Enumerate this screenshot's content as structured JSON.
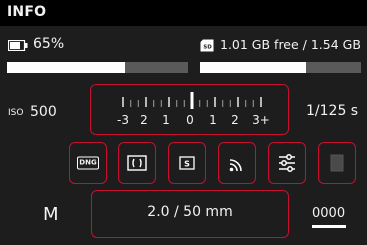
{
  "header": {
    "title": "INFO"
  },
  "status": {
    "battery_text": "65%",
    "battery_level": 0.65,
    "storage_text": "1.01 GB free / 1.54 GB",
    "storage_free_fraction": 0.656
  },
  "exposure": {
    "iso_label": "ISO",
    "iso_value": "500",
    "scale_labels": [
      "-3",
      "2",
      "1",
      "0",
      "1",
      "2",
      "3+"
    ],
    "compensation_ev": 0,
    "shutter_speed": "1/125 s"
  },
  "icons": [
    {
      "name": "dng-format-icon",
      "label": "DNG"
    },
    {
      "name": "metering-icon"
    },
    {
      "name": "stabilization-icon"
    },
    {
      "name": "wifi-icon"
    },
    {
      "name": "settings-icon"
    },
    {
      "name": "empty-slot-icon"
    }
  ],
  "mode": {
    "letter": "M"
  },
  "lens": {
    "text": "2.0 / 50 mm"
  },
  "counter": {
    "value": "0000"
  }
}
